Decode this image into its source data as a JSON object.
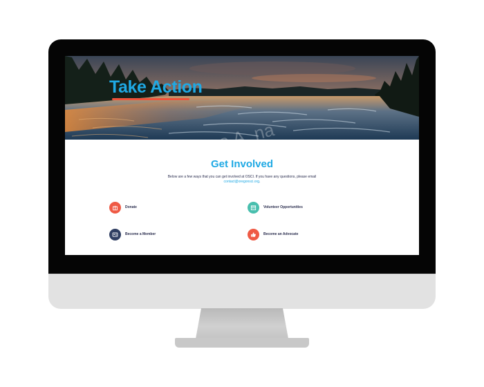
{
  "hero": {
    "title": "Take Action",
    "underline_color": "#f0523a"
  },
  "main": {
    "heading": "Get Involved",
    "intro_line1": "Below are a few ways that you can get involved at OSCI. If you have any questions, please email",
    "email": "contact@oregonsci.org",
    "intro_suffix": "."
  },
  "actions": [
    {
      "label": "Donate",
      "icon": "gift-icon",
      "color": "#ef5a45"
    },
    {
      "label": "Volunteer Opportunities",
      "icon": "calendar-icon",
      "color": "#49bfae"
    },
    {
      "label": "Become a Member",
      "icon": "id-card-icon",
      "color": "#2f3e62"
    },
    {
      "label": "Become an Advocate",
      "icon": "thumbs-up-icon",
      "color": "#ef5a45"
    }
  ],
  "colors": {
    "accent_blue": "#1fa9e4",
    "text_navy": "#2a2d4e",
    "monitor_bezel": "#050505",
    "monitor_chin": "#e2e2e2"
  }
}
